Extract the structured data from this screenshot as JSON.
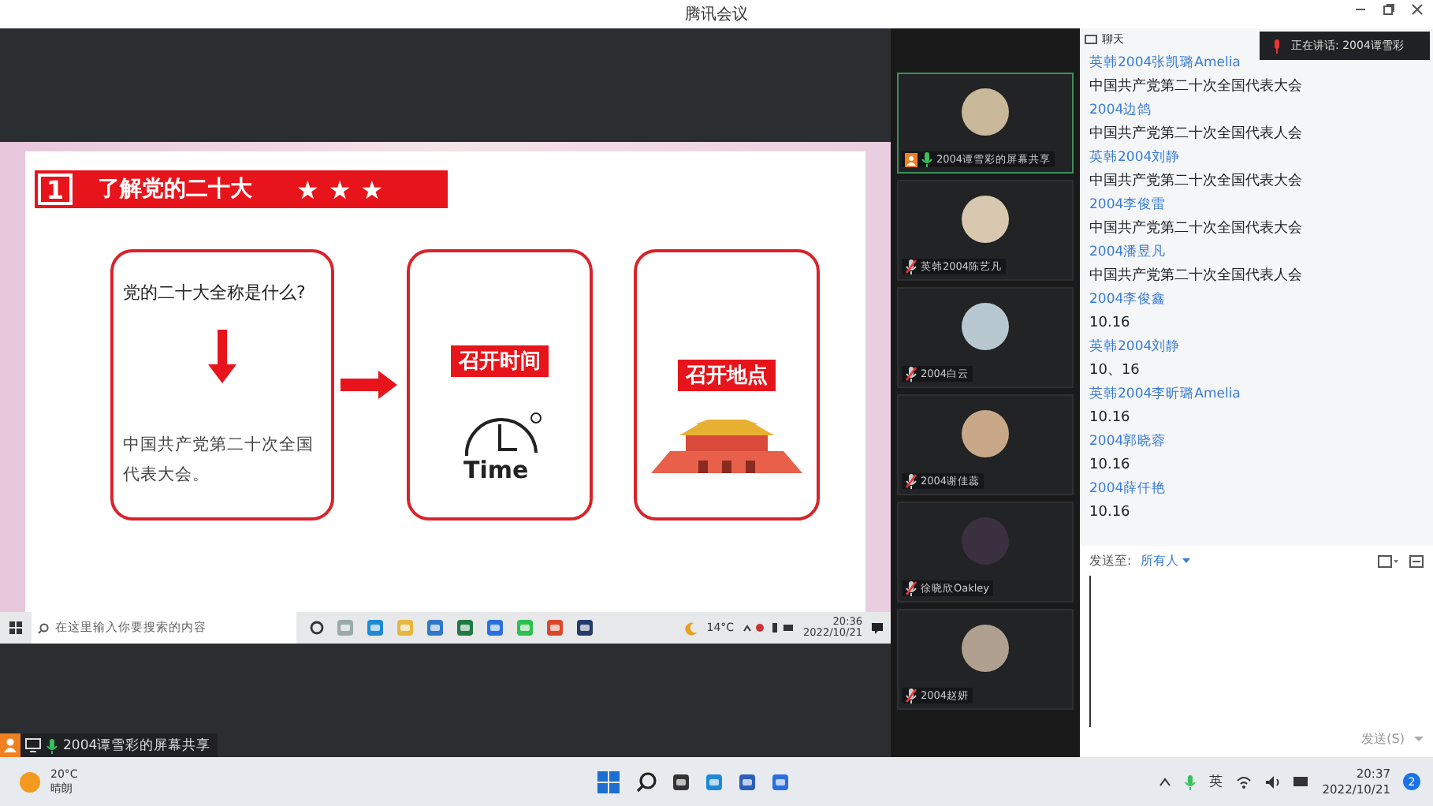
{
  "window": {
    "title": "腾讯会议"
  },
  "speaking_notice": "正在讲话: 2004谭雪彩",
  "shared_screen": {
    "label": "2004谭雪彩的屏幕共享",
    "slide": {
      "number": "1",
      "title": "了解党的二十大",
      "stars": [
        "★",
        "★",
        "★"
      ],
      "question": "党的二十大全称是什么?",
      "answer": "中国共产党第二十次全国代表大会。",
      "time_label": "召开时间",
      "clock_text": "Time",
      "place_label": "召开地点"
    },
    "taskbar": {
      "search_placeholder": "在这里输入你要搜索的内容",
      "weather": "14°C",
      "time": "20:36",
      "date": "2022/10/21"
    }
  },
  "participants": [
    {
      "name": "2004谭雪彩的屏幕共享",
      "selected": true,
      "muted": false
    },
    {
      "name": "英韩2004陈艺凡",
      "selected": false,
      "muted": true
    },
    {
      "name": "2004白云",
      "selected": false,
      "muted": true
    },
    {
      "name": "2004谢佳蕊",
      "selected": false,
      "muted": true
    },
    {
      "name": "徐晓欣Oakley",
      "selected": false,
      "muted": true
    },
    {
      "name": "2004赵妍",
      "selected": false,
      "muted": true
    }
  ],
  "chat": {
    "title": "聊天",
    "messages": [
      {
        "sender": "英韩2004张凯璐Amelia",
        "text": "中国共产党第二十次全国代表大会"
      },
      {
        "sender": "2004边鸽",
        "text": "中国共产党第二十次全国代表人会"
      },
      {
        "sender": "英韩2004刘静",
        "text": "中国共产党第二十次全国代表大会"
      },
      {
        "sender": "2004李俊雷",
        "text": "中国共产党第二十次全国代表大会"
      },
      {
        "sender": "2004潘昱凡",
        "text": "中国共产党第二十次全国代表人会"
      },
      {
        "sender": "2004李俊鑫",
        "text": "10.16"
      },
      {
        "sender": "英韩2004刘静",
        "text": "10、16"
      },
      {
        "sender": "英韩2004李昕璐Amelia",
        "text": "10.16"
      },
      {
        "sender": "2004郭晓蓉",
        "text": "10.16"
      },
      {
        "sender": "2004薛仟艳",
        "text": "10.16"
      }
    ],
    "send_to_label": "发送至:",
    "send_to_value": "所有人",
    "send_button": "发送(S)"
  },
  "taskbar": {
    "temperature": "20°C",
    "weather": "晴朗",
    "ime": "英",
    "time": "20:37",
    "date": "2022/10/21",
    "notifications": "2"
  }
}
